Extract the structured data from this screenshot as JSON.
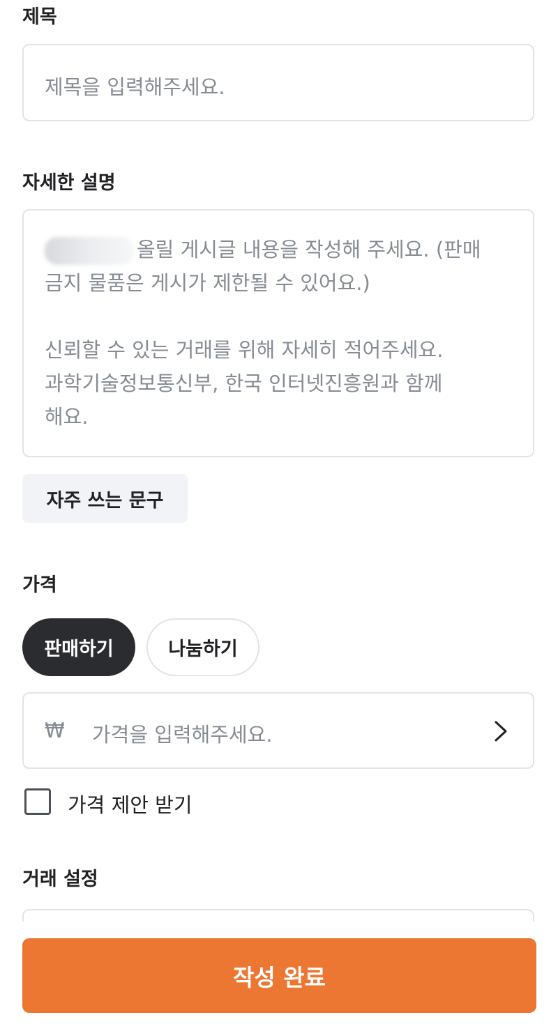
{
  "title_section": {
    "label": "제목",
    "placeholder": "제목을 입력해주세요."
  },
  "description_section": {
    "label": "자세한 설명",
    "placeholder_line1_tail": "올릴 게시글 내용을 작성해 주세요. (판매",
    "placeholder_line2": "금지 물품은 게시가 제한될 수 있어요.)",
    "placeholder_line3": "신뢰할 수 있는 거래를 위해 자세히 적어주세요.",
    "placeholder_line4": "과학기술정보통신부, 한국 인터넷진흥원과 함께",
    "placeholder_line5": "해요."
  },
  "frequent_phrases_button": "자주 쓰는 문구",
  "price_section": {
    "label": "가격",
    "chips": {
      "sell": "판매하기",
      "share": "나눔하기",
      "selected": "sell"
    },
    "currency_symbol": "₩",
    "placeholder": "가격을 입력해주세요.",
    "offer_checkbox_label": "가격 제안 받기",
    "offer_checked": false
  },
  "trade_section": {
    "label": "거래 설정"
  },
  "submit_button": "작성 완료",
  "colors": {
    "accent": "#ec7732",
    "selected_chip": "#2b2c30",
    "placeholder": "#868b94",
    "border": "#e2e3e6"
  },
  "icons": {
    "price_arrow": "chevron-right-icon"
  }
}
